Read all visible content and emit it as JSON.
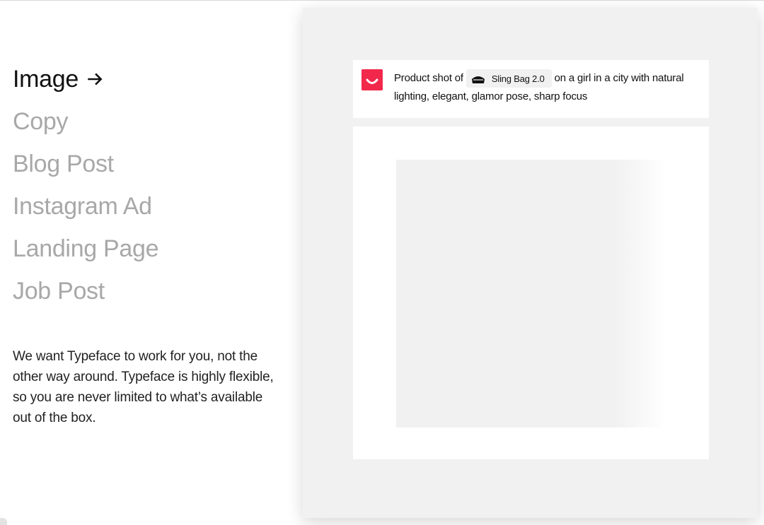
{
  "nav": {
    "items": [
      {
        "label": "Image",
        "active": true
      },
      {
        "label": "Copy",
        "active": false
      },
      {
        "label": "Blog Post",
        "active": false
      },
      {
        "label": "Instagram Ad",
        "active": false
      },
      {
        "label": "Landing Page",
        "active": false
      },
      {
        "label": "Job Post",
        "active": false
      }
    ],
    "active_icon": "arrow-right-icon"
  },
  "blurb": "We want Typeface to work for you, not the other way around. Typeface is highly flexible, so you are never limited to what’s available out of the box.",
  "prompt": {
    "logo_icon": "smile-logo-icon",
    "prefix": "Product shot of",
    "chip": {
      "icon": "sling-bag-icon",
      "label": "Sling Bag 2.0"
    },
    "suffix": "on a girl in a city with natural lighting, elegant, glamor pose, sharp focus"
  },
  "colors": {
    "brand": "#f2284b",
    "active_text": "#111111",
    "inactive_text": "#a8a8a8",
    "panel_bg": "#f1f1f1"
  }
}
